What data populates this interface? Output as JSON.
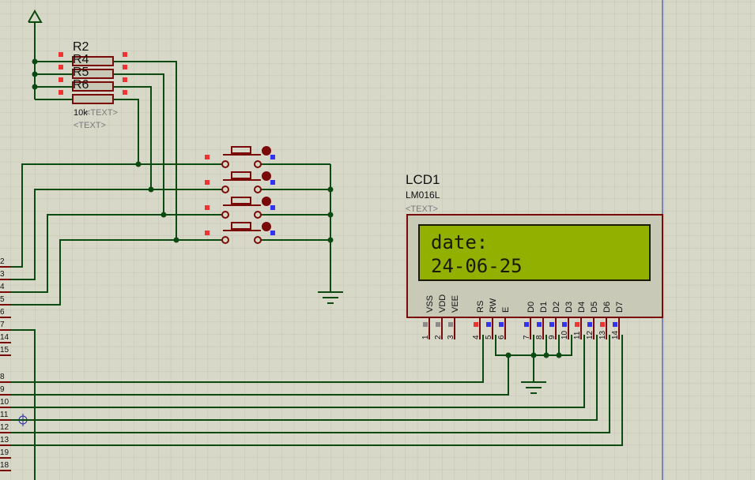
{
  "colors": {
    "background": "#d8d8c8",
    "grid": "#c3c3b4",
    "wire": "#0b4a10",
    "component": "#7a0a0a",
    "pin_red": "#ee3333",
    "pin_blue": "#3333ee",
    "pin_gray": "#8a8a8a",
    "lcd_body": "#c9c9b8",
    "lcd_screen": "#92b000",
    "lcd_text": "#1a1a00",
    "label": "#111111",
    "placeholder": "#7a7a7a",
    "cursor_line": "#2a2aa8"
  },
  "resistors": {
    "names": [
      "R2",
      "R4",
      "R5",
      "R6"
    ],
    "value": "10k",
    "text_placeholders": [
      "<TEXT>",
      "<TEXT>"
    ]
  },
  "lcd": {
    "ref": "LCD1",
    "model": "LM016L",
    "text_placeholder": "<TEXT>",
    "line1": "date:",
    "line2": "24-06-25",
    "pins": [
      {
        "num": "1",
        "name": "VSS",
        "state": "gray"
      },
      {
        "num": "2",
        "name": "VDD",
        "state": "gray"
      },
      {
        "num": "3",
        "name": "VEE",
        "state": "gray"
      },
      {
        "num": "4",
        "name": "RS",
        "state": "red"
      },
      {
        "num": "5",
        "name": "RW",
        "state": "blue"
      },
      {
        "num": "6",
        "name": "E",
        "state": "blue"
      },
      {
        "num": "7",
        "name": "D0",
        "state": "blue"
      },
      {
        "num": "8",
        "name": "D1",
        "state": "blue"
      },
      {
        "num": "9",
        "name": "D2",
        "state": "blue"
      },
      {
        "num": "10",
        "name": "D3",
        "state": "blue"
      },
      {
        "num": "11",
        "name": "D4",
        "state": "red"
      },
      {
        "num": "12",
        "name": "D5",
        "state": "blue"
      },
      {
        "num": "13",
        "name": "D6",
        "state": "red"
      },
      {
        "num": "14",
        "name": "D7",
        "state": "blue"
      }
    ]
  },
  "mcu_pins_left": [
    "2",
    "3",
    "4",
    "5",
    "6",
    "7",
    "14",
    "15",
    "8",
    "9",
    "10",
    "11",
    "12",
    "13",
    "19",
    "18"
  ],
  "buttons": {
    "count": 4
  }
}
